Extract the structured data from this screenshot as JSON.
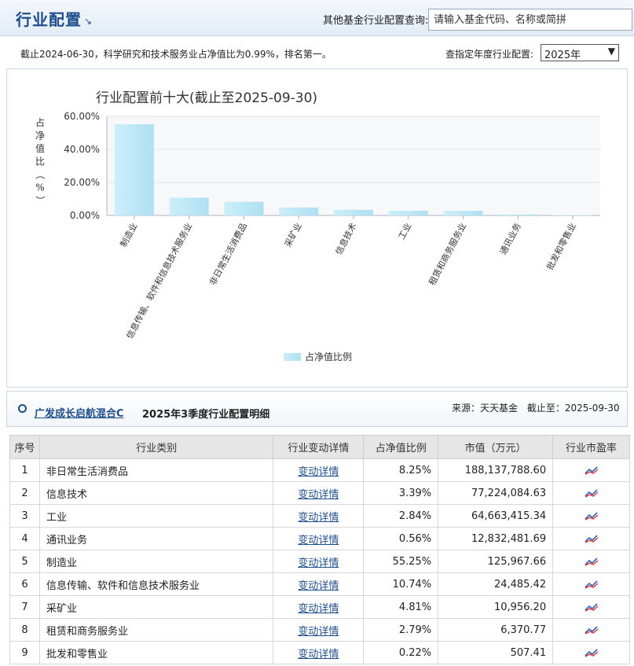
{
  "header": {
    "title": "行业配置",
    "query_label": "其他基金行业配置查询:",
    "query_placeholder": "请输入基金代码、名称或简拼"
  },
  "info": {
    "note": "截止2024-06-30，科学研究和技术服务业占净值比为0.99%，排名第一。",
    "year_label": "查指定年度行业配置:",
    "year_value": "2025年"
  },
  "chart_data": {
    "type": "bar",
    "title": "行业配置前十大(截止至2025-09-30)",
    "ylabel": "占净值比（%）",
    "ylim": [
      0,
      60
    ],
    "yticks": [
      "0.00%",
      "20.00%",
      "40.00%",
      "60.00%"
    ],
    "categories": [
      "制造业",
      "信息传输、软件和信息技术服务业",
      "非日常生活消费品",
      "采矿业",
      "信息技术",
      "工业",
      "租赁和商务服务业",
      "通讯业务",
      "批发和零售业"
    ],
    "series": [
      {
        "name": "占净值比例",
        "values": [
          55.25,
          10.74,
          8.25,
          4.81,
          3.39,
          2.84,
          2.79,
          0.56,
          0.22
        ]
      }
    ],
    "legend": "bottom-center",
    "bar_color": "#bfe6f4"
  },
  "detail": {
    "fund_name": "广发成长启航混合C",
    "section_title": "2025年3季度行业配置明细",
    "source": "来源：天天基金",
    "as_of": "截止至：2025-09-30",
    "columns": [
      "序号",
      "行业类别",
      "行业变动详情",
      "占净值比例",
      "市值（万元）",
      "行业市盈率"
    ],
    "rows": [
      {
        "idx": "1",
        "name": "非日常生活消费品",
        "link": "变动详情",
        "pct": "8.25%",
        "mv": "188,137,788.60"
      },
      {
        "idx": "2",
        "name": "信息技术",
        "link": "变动详情",
        "pct": "3.39%",
        "mv": "77,224,084.63"
      },
      {
        "idx": "3",
        "name": "工业",
        "link": "变动详情",
        "pct": "2.84%",
        "mv": "64,663,415.34"
      },
      {
        "idx": "4",
        "name": "通讯业务",
        "link": "变动详情",
        "pct": "0.56%",
        "mv": "12,832,481.69"
      },
      {
        "idx": "5",
        "name": "制造业",
        "link": "变动详情",
        "pct": "55.25%",
        "mv": "125,967.66"
      },
      {
        "idx": "6",
        "name": "信息传输、软件和信息技术服务业",
        "link": "变动详情",
        "pct": "10.74%",
        "mv": "24,485.42"
      },
      {
        "idx": "7",
        "name": "采矿业",
        "link": "变动详情",
        "pct": "4.81%",
        "mv": "10,956.20"
      },
      {
        "idx": "8",
        "name": "租赁和商务服务业",
        "link": "变动详情",
        "pct": "2.79%",
        "mv": "6,370.77"
      },
      {
        "idx": "9",
        "name": "批发和零售业",
        "link": "变动详情",
        "pct": "0.22%",
        "mv": "507.41"
      }
    ],
    "pe_icon": "trend-chart-icon"
  }
}
